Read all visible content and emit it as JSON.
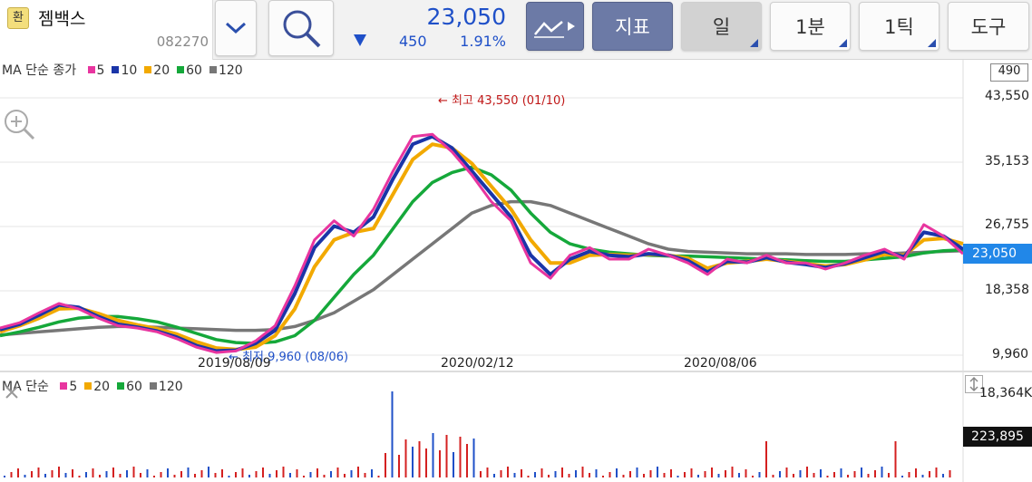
{
  "header": {
    "exchange_badge": "환",
    "stock_name": "젬백스",
    "stock_code": "082270",
    "price": "23,050",
    "change": "450",
    "change_pct": "1.91%",
    "indicator_label": "지표",
    "period_day": "일",
    "period_min": "1분",
    "period_tick": "1틱",
    "tools_label": "도구",
    "colors": {
      "down": "#1f50c8",
      "up": "#d42020"
    }
  },
  "price_legend": {
    "prefix": "MA 단순 종가",
    "items": [
      {
        "label": "5",
        "color": "#e8359f"
      },
      {
        "label": "10",
        "color": "#1a35a8"
      },
      {
        "label": "20",
        "color": "#f2a900"
      },
      {
        "label": "60",
        "color": "#15a83a"
      },
      {
        "label": "120",
        "color": "#777777"
      }
    ]
  },
  "volume_legend": {
    "prefix": "MA 단순",
    "items": [
      {
        "label": "5",
        "color": "#e8359f"
      },
      {
        "label": "20",
        "color": "#f2a900"
      },
      {
        "label": "60",
        "color": "#15a83a"
      },
      {
        "label": "120",
        "color": "#777777"
      }
    ]
  },
  "axis": {
    "unit_box": "490",
    "y_labels": [
      "43,550",
      "35,153",
      "26,755",
      "18,358",
      "9,960"
    ],
    "x_labels": [
      "2019/08/09",
      "2020/02/12",
      "2020/08/06"
    ],
    "current_price_tag": "23,050",
    "volume_max": "18,364K",
    "volume_current_tag": "223,895"
  },
  "annotations": {
    "high": "← 최고 43,550 (01/10)",
    "low": "← 최저 9,960 (08/06)"
  },
  "chart_data": {
    "type": "candlestick",
    "ylim": [
      9960,
      43550
    ],
    "y_ticks": [
      43550,
      35153,
      26755,
      18358,
      9960
    ],
    "x_ticks": [
      "2019/08/09",
      "2020/02/12",
      "2020/08/06"
    ],
    "high": {
      "value": 43550,
      "date": "01/10"
    },
    "low": {
      "value": 9960,
      "date": "08/06"
    },
    "last_close": 23050,
    "series": [
      {
        "name": "5",
        "color": "#e8359f",
        "values": [
          13500,
          14200,
          15500,
          16700,
          16000,
          14800,
          13800,
          13500,
          13000,
          12100,
          11000,
          10300,
          10500,
          11800,
          13800,
          19000,
          25000,
          27500,
          25500,
          29000,
          34000,
          38500,
          38800,
          36500,
          33500,
          30000,
          27500,
          22000,
          20000,
          23000,
          24000,
          22500,
          22500,
          23800,
          23000,
          22000,
          20500,
          22500,
          22000,
          23000,
          22000,
          22000,
          21200,
          22000,
          23000,
          23800,
          22500,
          27000,
          25500,
          23200
        ]
      },
      {
        "name": "10",
        "color": "#1a35a8",
        "values": [
          13300,
          14000,
          15200,
          16500,
          16200,
          15000,
          14000,
          13600,
          13100,
          12300,
          11200,
          10500,
          10600,
          11500,
          13200,
          18000,
          24000,
          26800,
          26000,
          28000,
          33000,
          37500,
          38500,
          37000,
          34000,
          31000,
          28000,
          23000,
          20500,
          22500,
          23500,
          23000,
          22800,
          23200,
          23000,
          22300,
          20800,
          22200,
          22100,
          22700,
          22100,
          21800,
          21400,
          21900,
          22700,
          23500,
          22800,
          26000,
          25500,
          23800
        ]
      },
      {
        "name": "20",
        "color": "#f2a900",
        "values": [
          13000,
          13800,
          14800,
          16000,
          16100,
          15400,
          14500,
          13900,
          13400,
          12700,
          11700,
          10900,
          10700,
          11000,
          12500,
          16000,
          21500,
          25000,
          26000,
          26500,
          31000,
          35500,
          37500,
          37000,
          35000,
          32000,
          29000,
          25000,
          22000,
          22000,
          23000,
          23100,
          23000,
          23100,
          23000,
          22600,
          21300,
          22000,
          22200,
          22500,
          22200,
          21900,
          21600,
          21800,
          22400,
          23100,
          23000,
          25000,
          25200,
          24500
        ]
      },
      {
        "name": "60",
        "color": "#15a83a",
        "values": [
          12500,
          13000,
          13600,
          14300,
          14800,
          15000,
          15000,
          14700,
          14300,
          13600,
          12800,
          12000,
          11600,
          11500,
          11700,
          12500,
          14500,
          17500,
          20500,
          23000,
          26500,
          30000,
          32500,
          33800,
          34500,
          33500,
          31500,
          28500,
          26000,
          24500,
          23800,
          23400,
          23200,
          23000,
          22900,
          22900,
          22800,
          22700,
          22600,
          22500,
          22400,
          22300,
          22200,
          22200,
          22400,
          22600,
          22800,
          23300,
          23600,
          23700
        ]
      },
      {
        "name": "120",
        "color": "#777777",
        "values": [
          12600,
          12800,
          13000,
          13200,
          13400,
          13600,
          13700,
          13700,
          13600,
          13500,
          13400,
          13300,
          13200,
          13200,
          13300,
          13700,
          14500,
          15500,
          17000,
          18500,
          20500,
          22500,
          24500,
          26500,
          28500,
          29500,
          30000,
          30000,
          29500,
          28500,
          27500,
          26500,
          25500,
          24500,
          23800,
          23500,
          23400,
          23300,
          23200,
          23200,
          23200,
          23100,
          23100,
          23100,
          23200,
          23200,
          23300,
          23400,
          23500,
          23600
        ]
      }
    ]
  }
}
